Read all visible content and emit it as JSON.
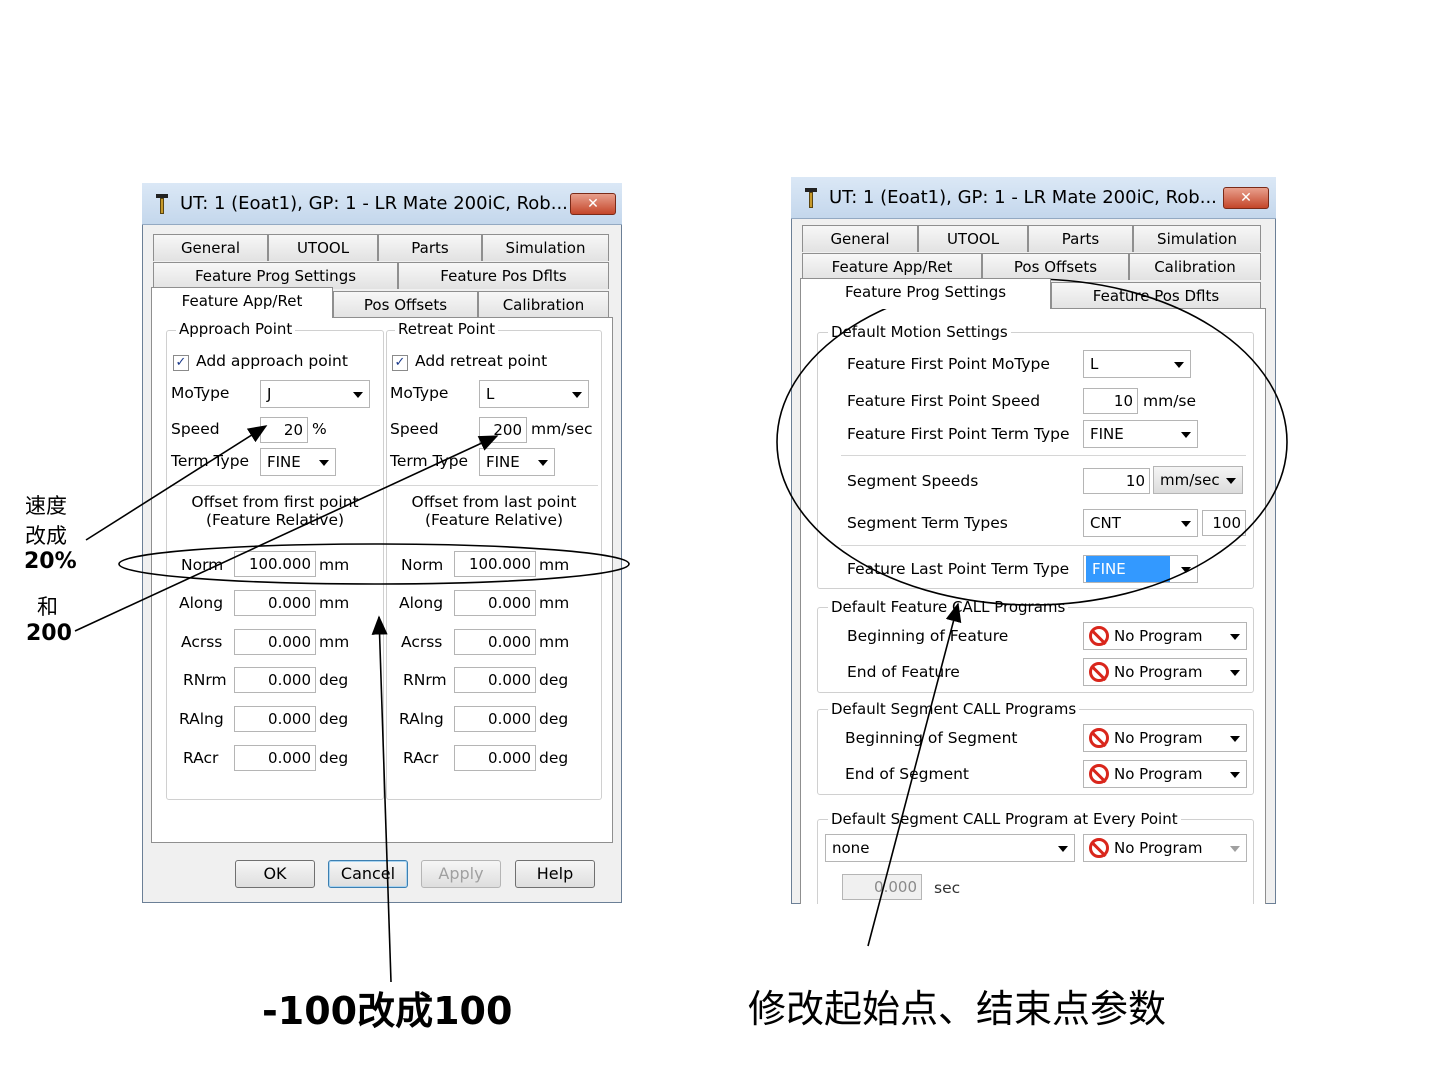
{
  "left_window": {
    "title": "UT: 1  (Eoat1), GP: 1 - LR Mate 200iC, Rob...",
    "close_label": "✕",
    "tabs_row1": [
      "General",
      "UTOOL",
      "Parts",
      "Simulation"
    ],
    "tabs_row2": [
      "Feature Prog Settings",
      "Feature Pos Dflts"
    ],
    "tabs_row3": [
      "Feature App/Ret",
      "Pos Offsets",
      "Calibration"
    ],
    "active_tab": "Feature App/Ret",
    "approach": {
      "group_title": "Approach Point",
      "checkbox_label": "Add approach point",
      "checked": true,
      "motype_label": "MoType",
      "motype_value": "J",
      "speed_label": "Speed",
      "speed_value": "20",
      "speed_unit": "%",
      "term_label": "Term Type",
      "term_value": "FINE",
      "offset_title_1": "Offset from first point",
      "offset_title_2": "(Feature Relative)",
      "offsets": [
        {
          "label": "Norm",
          "value": "100.000",
          "unit": "mm"
        },
        {
          "label": "Along",
          "value": "0.000",
          "unit": "mm"
        },
        {
          "label": "Acrss",
          "value": "0.000",
          "unit": "mm"
        },
        {
          "label": "RNrm",
          "value": "0.000",
          "unit": "deg"
        },
        {
          "label": "RAlng",
          "value": "0.000",
          "unit": "deg"
        },
        {
          "label": "RAcr",
          "value": "0.000",
          "unit": "deg"
        }
      ]
    },
    "retreat": {
      "group_title": "Retreat Point",
      "checkbox_label": "Add retreat point",
      "checked": true,
      "motype_label": "MoType",
      "motype_value": "L",
      "speed_label": "Speed",
      "speed_value": "200",
      "speed_unit": "mm/sec",
      "term_label": "Term Type",
      "term_value": "FINE",
      "offset_title_1": "Offset from last point",
      "offset_title_2": "(Feature Relative)",
      "offsets": [
        {
          "label": "Norm",
          "value": "100.000",
          "unit": "mm"
        },
        {
          "label": "Along",
          "value": "0.000",
          "unit": "mm"
        },
        {
          "label": "Acrss",
          "value": "0.000",
          "unit": "mm"
        },
        {
          "label": "RNrm",
          "value": "0.000",
          "unit": "deg"
        },
        {
          "label": "RAlng",
          "value": "0.000",
          "unit": "deg"
        },
        {
          "label": "RAcr",
          "value": "0.000",
          "unit": "deg"
        }
      ]
    },
    "buttons": {
      "ok": "OK",
      "cancel": "Cancel",
      "apply": "Apply",
      "help": "Help"
    }
  },
  "right_window": {
    "title": "UT: 1  (Eoat1), GP: 1 - LR Mate 200iC, Rob...",
    "close_label": "✕",
    "tabs_row1": [
      "General",
      "UTOOL",
      "Parts",
      "Simulation"
    ],
    "tabs_row2": [
      "Feature App/Ret",
      "Pos Offsets",
      "Calibration"
    ],
    "tabs_row3": [
      "Feature Prog Settings",
      "Feature Pos Dflts"
    ],
    "active_tab": "Feature Prog Settings",
    "motion": {
      "group_title": "Default Motion Settings",
      "first_motype_label": "Feature First Point MoType",
      "first_motype_value": "L",
      "first_speed_label": "Feature First Point Speed",
      "first_speed_value": "10",
      "first_speed_unit": "mm/se",
      "first_term_label": "Feature First Point Term Type",
      "first_term_value": "FINE",
      "seg_speed_label": "Segment Speeds",
      "seg_speed_value": "10",
      "seg_speed_unit": "mm/sec",
      "seg_term_label": "Segment Term Types",
      "seg_term_value": "CNT",
      "seg_term_cnt": "100",
      "last_term_label": "Feature Last Point Term Type",
      "last_term_value": "FINE"
    },
    "feature_call": {
      "group_title": "Default Feature CALL Programs",
      "begin_label": "Beginning of Feature",
      "begin_value": "No Program",
      "end_label": "End of Feature",
      "end_value": "No Program"
    },
    "segment_call": {
      "group_title": "Default Segment CALL Programs",
      "begin_label": "Beginning of Segment",
      "begin_value": "No Program",
      "end_label": "End of Segment",
      "end_value": "No Program"
    },
    "every_point": {
      "group_title": "Default Segment CALL Program at Every Point",
      "mode_value": "none",
      "program_value": "No Program",
      "time_value": "0.000",
      "time_unit": "sec"
    }
  },
  "annotations": {
    "speed_note_1": "速度",
    "speed_note_2": "改成",
    "speed_note_3": "20%",
    "speed_note_4": "和",
    "speed_note_5": "200",
    "bottom_left": "-100改成100",
    "bottom_right": "修改起始点、结束点参数"
  }
}
